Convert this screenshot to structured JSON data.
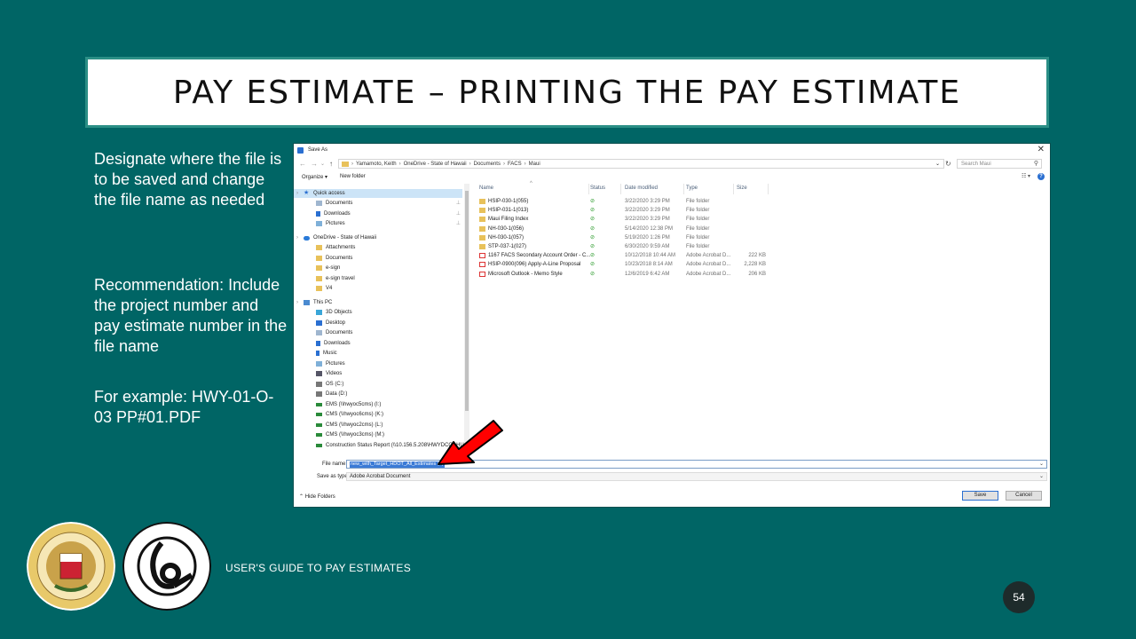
{
  "slide": {
    "title": "PAY ESTIMATE – PRINTING THE PAY ESTIMATE",
    "body_1": "Designate where the file is to be saved and change the file name as needed",
    "body_2": "Recommendation: Include the project number and pay estimate number in the file name",
    "body_3": "For example: HWY-01-O-03 PP#01.PDF",
    "footer": "USER'S GUIDE TO PAY ESTIMATES",
    "page_number": "54",
    "colors": {
      "background": "#006565",
      "title_border": "#2b8f86",
      "arrow": "#ff0000"
    }
  },
  "dialog": {
    "title": "Save As",
    "breadcrumbs": [
      "Yamamoto, Keith",
      "OneDrive - State of Hawaii",
      "Documents",
      "FACS",
      "Maui"
    ],
    "search_placeholder": "Search Maui",
    "toolbar": {
      "organize": "Organize ▾",
      "new_folder": "New folder"
    },
    "nav_items": [
      {
        "label": "Quick access",
        "icon": "star-icon",
        "pinned": false
      },
      {
        "label": "Documents",
        "icon": "documents-icon",
        "pinned": true
      },
      {
        "label": "Downloads",
        "icon": "download-icon",
        "pinned": true
      },
      {
        "label": "Pictures",
        "icon": "pictures-icon",
        "pinned": true
      },
      {
        "label": "OneDrive - State of Hawaii",
        "icon": "cloud-icon",
        "pinned": false
      },
      {
        "label": "Attachments",
        "icon": "folder-icon",
        "pinned": false
      },
      {
        "label": "Documents",
        "icon": "folder-icon",
        "pinned": false
      },
      {
        "label": "e-sign",
        "icon": "folder-icon",
        "pinned": false
      },
      {
        "label": "e-sign travel",
        "icon": "folder-icon",
        "pinned": false
      },
      {
        "label": "V4",
        "icon": "folder-icon",
        "pinned": false
      },
      {
        "label": "This PC",
        "icon": "pc-icon",
        "pinned": false
      },
      {
        "label": "3D Objects",
        "icon": "3d-objects-icon",
        "pinned": false
      },
      {
        "label": "Desktop",
        "icon": "desktop-icon",
        "pinned": false
      },
      {
        "label": "Documents",
        "icon": "documents-icon",
        "pinned": false
      },
      {
        "label": "Downloads",
        "icon": "download-icon",
        "pinned": false
      },
      {
        "label": "Music",
        "icon": "music-icon",
        "pinned": false
      },
      {
        "label": "Pictures",
        "icon": "pictures-icon",
        "pinned": false
      },
      {
        "label": "Videos",
        "icon": "videos-icon",
        "pinned": false
      },
      {
        "label": "OS (C:)",
        "icon": "drive-icon",
        "pinned": false
      },
      {
        "label": "Data (D:)",
        "icon": "drive-icon",
        "pinned": false
      },
      {
        "label": "EMS (\\\\hwyoc5cms) (I:)",
        "icon": "network-drive-icon",
        "pinned": false
      },
      {
        "label": "CMS (\\\\hwyoc6cms) (K:)",
        "icon": "network-drive-icon",
        "pinned": false
      },
      {
        "label": "CMS (\\\\hwyoc2cms) (L:)",
        "icon": "network-drive-icon",
        "pinned": false
      },
      {
        "label": "CMS (\\\\hwyoc3cms) (M:)",
        "icon": "network-drive-icon",
        "pinned": false
      },
      {
        "label": "Construction Status Report (\\\\10.156.5.208\\HWYDCOAHU) (",
        "icon": "network-drive-icon",
        "pinned": false
      }
    ],
    "columns": [
      "Name",
      "Status",
      "Date modified",
      "Type",
      "Size"
    ],
    "files": [
      {
        "name": "HSIP-030-1(055)",
        "date": "3/22/2020 3:29 PM",
        "type": "File folder",
        "size": "",
        "kind": "folder"
      },
      {
        "name": "HSIP-031-1(013)",
        "date": "3/22/2020 3:29 PM",
        "type": "File folder",
        "size": "",
        "kind": "folder"
      },
      {
        "name": "Maui Filing Index",
        "date": "3/22/2020 3:29 PM",
        "type": "File folder",
        "size": "",
        "kind": "folder"
      },
      {
        "name": "NH-030-1(056)",
        "date": "5/14/2020 12:38 PM",
        "type": "File folder",
        "size": "",
        "kind": "folder"
      },
      {
        "name": "NH-030-1(057)",
        "date": "5/19/2020 1:26 PM",
        "type": "File folder",
        "size": "",
        "kind": "folder"
      },
      {
        "name": "STP-037-1(027)",
        "date": "6/30/2020 9:59 AM",
        "type": "File folder",
        "size": "",
        "kind": "folder"
      },
      {
        "name": "1167 FACS Secondary Account Order - C...",
        "date": "10/12/2018 10:44 AM",
        "type": "Adobe Acrobat D...",
        "size": "222 KB",
        "kind": "pdf"
      },
      {
        "name": "HSIP-0900(096) Apply-A-Line Proposal",
        "date": "10/23/2018 8:14 AM",
        "type": "Adobe Acrobat D...",
        "size": "2,228 KB",
        "kind": "pdf"
      },
      {
        "name": "Microsoft Outlook - Memo Style",
        "date": "12/6/2019 6:42 AM",
        "type": "Adobe Acrobat D...",
        "size": "206 KB",
        "kind": "pdf"
      }
    ],
    "file_name_label": "File name:",
    "file_name_value": "new_with_Target_HDOT_All_Estimates (5)",
    "save_type_label": "Save as type:",
    "save_type_value": "Adobe Acrobat Document",
    "hide_folders": "Hide Folders",
    "save_button": "Save",
    "cancel_button": "Cancel"
  }
}
